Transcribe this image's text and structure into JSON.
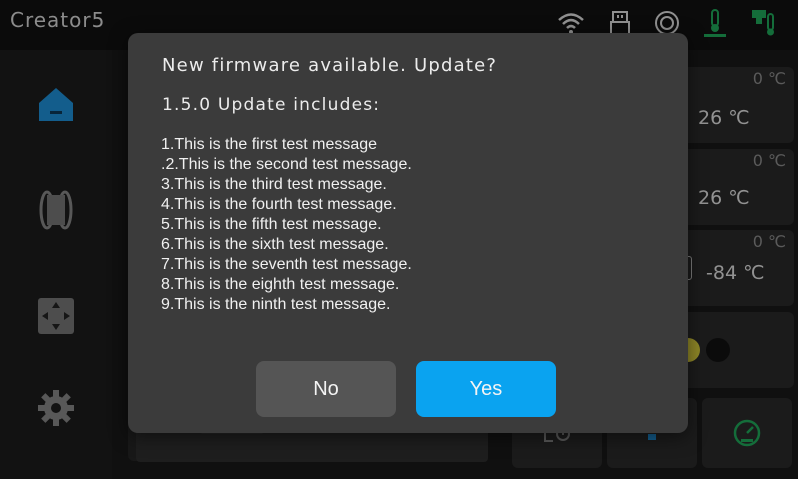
{
  "app": {
    "title": "Creator5"
  },
  "status_icons": [
    "wifi-icon",
    "usb-icon",
    "target-icon",
    "bed-temperature-icon",
    "nozzle-temperature-icon"
  ],
  "nav": {
    "items": [
      "home-icon",
      "filament-spool-icon",
      "move-axis-icon",
      "settings-gear-icon"
    ]
  },
  "temps": [
    {
      "target": "0 ℃",
      "current": "26 ℃"
    },
    {
      "target": "0 ℃",
      "current": "26 ℃"
    },
    {
      "target": "0 ℃",
      "current": "-84 ℃"
    }
  ],
  "bottom_buttons": [
    "led-icon",
    "light-bulb-icon",
    "speed-gauge-icon"
  ],
  "dialog": {
    "title": "New firmware available. Update?",
    "subtitle": "1.5.0 Update includes:",
    "items": [
      "1.This is the first test message",
      ".2.This is the second test message.",
      "3.This is the third test message.",
      "4.This is the fourth test message.",
      "5.This is the fifth test message.",
      "6.This is the sixth test message.",
      "7.This is the seventh test message.",
      "8.This is the eighth test message.",
      "9.This is the ninth test message."
    ],
    "no_label": "No",
    "yes_label": "Yes"
  },
  "colors": {
    "accent": "#0aa3f0",
    "nav_active": "#1e8fd8",
    "status_green": "#1fa85a"
  }
}
